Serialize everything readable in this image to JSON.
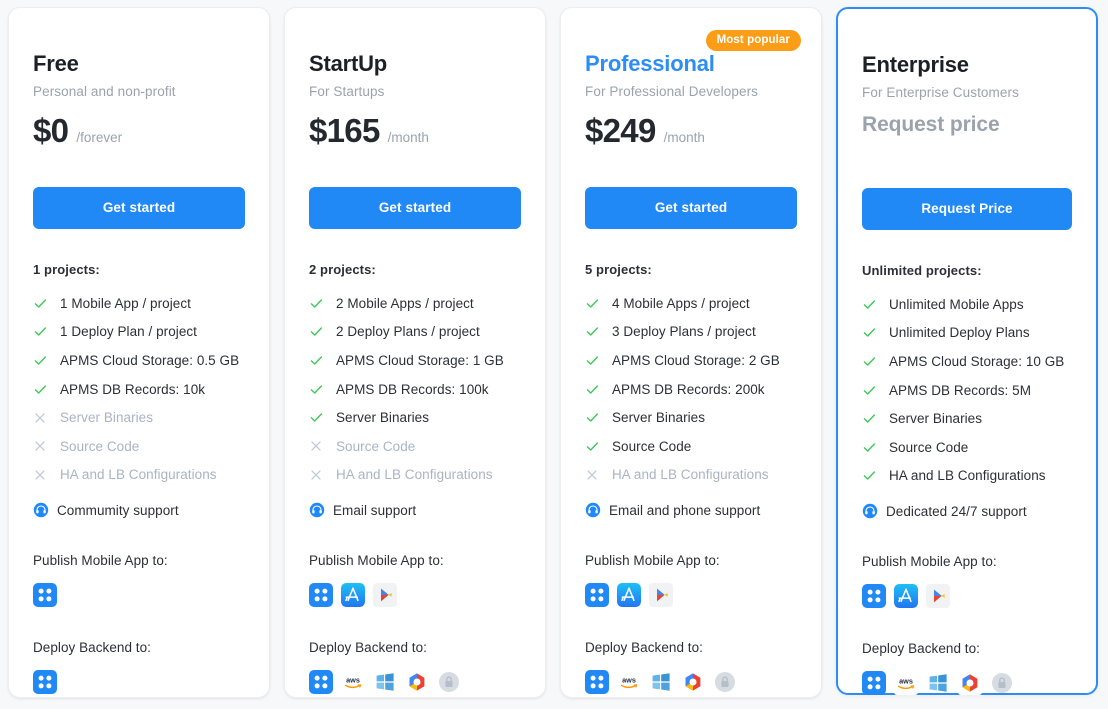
{
  "page": {
    "background": "#f7f8fa",
    "accent_blue": "#2089f5",
    "badge_orange": "#fb9d16",
    "check_green": "#3ec75a",
    "muted_grey": "#a9b4c4"
  },
  "publish_label": "Publish Mobile App to:",
  "deploy_label": "Deploy Backend to:",
  "plans": [
    {
      "name": "Free",
      "tagline": "Personal and non-profit",
      "price": "$0",
      "period": "/forever",
      "cta": "Get started",
      "badge": null,
      "featured": false,
      "accent_name": false,
      "projects": "1 projects:",
      "features": [
        {
          "text": "1 Mobile App / project",
          "included": true
        },
        {
          "text": "1 Deploy Plan / project",
          "included": true
        },
        {
          "text": "APMS Cloud Storage: 0.5 GB",
          "included": true
        },
        {
          "text": "APMS DB Records: 10k",
          "included": true
        },
        {
          "text": "Server Binaries",
          "included": false
        },
        {
          "text": "Source Code",
          "included": false
        },
        {
          "text": "HA and LB Configurations",
          "included": false
        }
      ],
      "support": "Commumity support",
      "publish_icons": [
        "apms-icon"
      ],
      "deploy_icons": [
        "apms-icon"
      ]
    },
    {
      "name": "StartUp",
      "tagline": "For Startups",
      "price": "$165",
      "period": "/month",
      "cta": "Get started",
      "badge": null,
      "featured": false,
      "accent_name": false,
      "projects": "2 projects:",
      "features": [
        {
          "text": "2 Mobile Apps / project",
          "included": true
        },
        {
          "text": "2 Deploy Plans / project",
          "included": true
        },
        {
          "text": "APMS Cloud Storage: 1 GB",
          "included": true
        },
        {
          "text": "APMS DB Records: 100k",
          "included": true
        },
        {
          "text": "Server Binaries",
          "included": true
        },
        {
          "text": "Source Code",
          "included": false
        },
        {
          "text": "HA and LB Configurations",
          "included": false
        }
      ],
      "support": "Email support",
      "publish_icons": [
        "apms-icon",
        "app-store-icon",
        "google-play-icon"
      ],
      "deploy_icons": [
        "apms-icon",
        "aws-icon",
        "azure-icon",
        "google-cloud-icon",
        "locked-icon"
      ]
    },
    {
      "name": "Professional",
      "tagline": "For Professional Developers",
      "price": "$249",
      "period": "/month",
      "cta": "Get started",
      "badge": "Most popular",
      "featured": false,
      "accent_name": true,
      "projects": "5 projects:",
      "features": [
        {
          "text": "4 Mobile Apps / project",
          "included": true
        },
        {
          "text": "3 Deploy Plans / project",
          "included": true
        },
        {
          "text": "APMS Cloud Storage: 2 GB",
          "included": true
        },
        {
          "text": "APMS DB Records: 200k",
          "included": true
        },
        {
          "text": "Server Binaries",
          "included": true
        },
        {
          "text": "Source Code",
          "included": true
        },
        {
          "text": "HA and LB Configurations",
          "included": false
        }
      ],
      "support": "Email and phone support",
      "publish_icons": [
        "apms-icon",
        "app-store-icon",
        "google-play-icon"
      ],
      "deploy_icons": [
        "apms-icon",
        "aws-icon",
        "azure-icon",
        "google-cloud-icon",
        "locked-icon"
      ]
    },
    {
      "name": "Enterprise",
      "tagline": "For Enterprise Customers",
      "price": "Request price",
      "period": "",
      "cta": "Request Price",
      "badge": null,
      "featured": true,
      "accent_name": false,
      "projects": "Unlimited projects:",
      "features": [
        {
          "text": "Unlimited Mobile Apps",
          "included": true
        },
        {
          "text": "Unlimited Deploy Plans",
          "included": true
        },
        {
          "text": "APMS Cloud Storage: 10 GB",
          "included": true
        },
        {
          "text": "APMS DB Records: 5M",
          "included": true
        },
        {
          "text": "Server Binaries",
          "included": true
        },
        {
          "text": "Source Code",
          "included": true
        },
        {
          "text": "HA and LB Configurations",
          "included": true
        }
      ],
      "support": "Dedicated 24/7 support",
      "publish_icons": [
        "apms-icon",
        "app-store-icon",
        "google-play-icon"
      ],
      "deploy_icons": [
        "apms-icon",
        "aws-icon",
        "azure-icon",
        "google-cloud-icon",
        "locked-icon"
      ]
    }
  ]
}
